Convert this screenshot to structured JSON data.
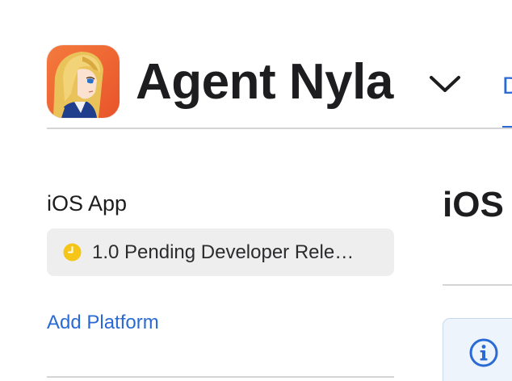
{
  "header": {
    "app_name": "Agent Nyla",
    "tab_peek_label": "D",
    "icon_names": {
      "app_icon": "app-icon-anime-character",
      "chevron": "chevron-down-icon"
    }
  },
  "sidebar": {
    "section_label": "iOS App",
    "version": {
      "label": "1.0 Pending Developer Rele…",
      "status": "pending",
      "status_color": "#f5c518"
    },
    "add_platform_label": "Add Platform"
  },
  "main": {
    "heading": "iOS",
    "info_icon": "info-circle-icon"
  },
  "colors": {
    "accent": "#2a6ad4",
    "pill_background": "#eeeeef",
    "divider": "#d5d5d7",
    "info_background": "#eef4fc"
  }
}
